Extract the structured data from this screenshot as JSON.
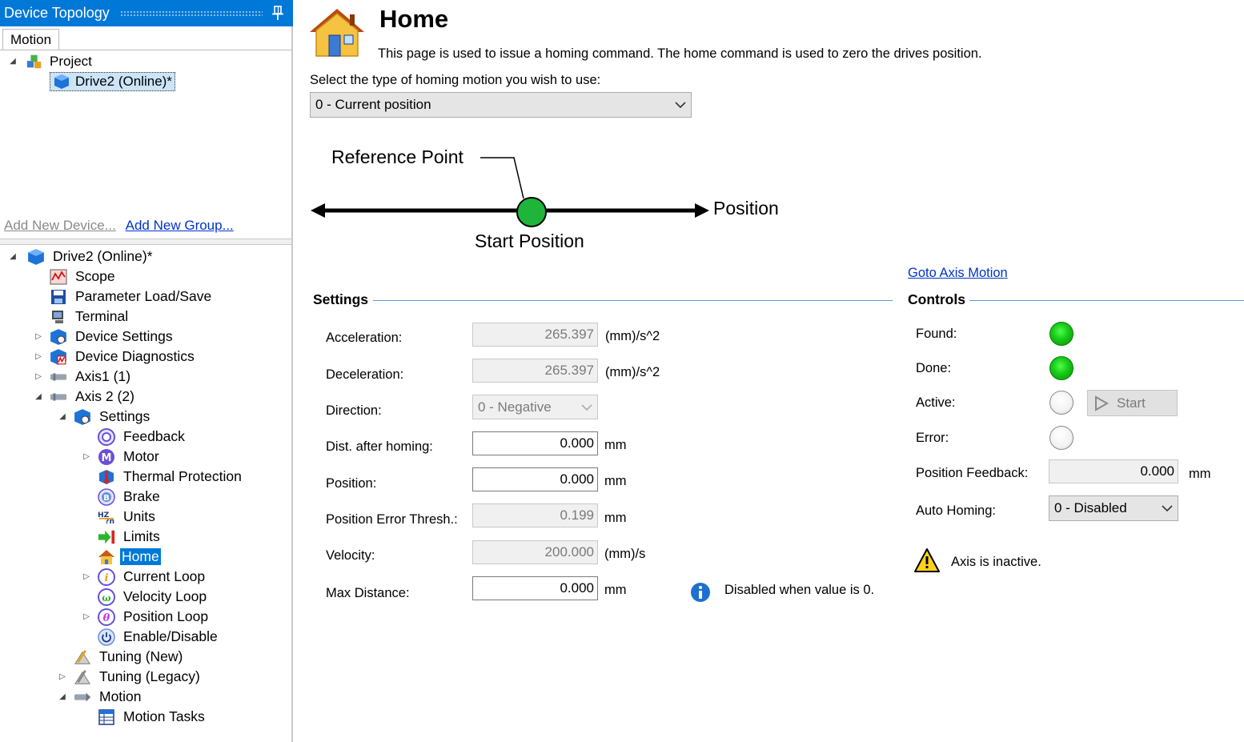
{
  "topology": {
    "title": "Device Topology",
    "tab": "Motion",
    "project_label": "Project",
    "drive_online_label": "Drive2 (Online)*",
    "add_device_link": "Add New Device...",
    "add_group_link": "Add New Group..."
  },
  "tree": {
    "root": "Drive2 (Online)*",
    "scope": "Scope",
    "param": "Parameter Load/Save",
    "terminal": "Terminal",
    "device_settings": "Device Settings",
    "device_diagnostics": "Device Diagnostics",
    "axis1": "Axis1 (1)",
    "axis2": "Axis 2 (2)",
    "settings": "Settings",
    "feedback": "Feedback",
    "motor": "Motor",
    "thermal": "Thermal Protection",
    "brake": "Brake",
    "units": "Units",
    "limits": "Limits",
    "home": "Home",
    "current_loop": "Current Loop",
    "velocity_loop": "Velocity Loop",
    "position_loop": "Position Loop",
    "enable_disable": "Enable/Disable",
    "tuning_new": "Tuning (New)",
    "tuning_legacy": "Tuning (Legacy)",
    "motion": "Motion",
    "motion_tasks": "Motion Tasks"
  },
  "page": {
    "title": "Home",
    "description": "This page is used to issue a homing command. The home command is used to zero the drives position.",
    "select_label": "Select the type of homing motion you wish to use:",
    "homing_type": "0 - Current position"
  },
  "diagram": {
    "reference_point": "Reference Point",
    "position": "Position",
    "start_position": "Start Position"
  },
  "settings": {
    "title": "Settings",
    "acceleration_label": "Acceleration:",
    "acceleration_value": "265.397",
    "acceleration_unit": "(mm)/s^2",
    "deceleration_label": "Deceleration:",
    "deceleration_value": "265.397",
    "deceleration_unit": "(mm)/s^2",
    "direction_label": "Direction:",
    "direction_value": "0 - Negative",
    "dist_label": "Dist. after homing:",
    "dist_value": "0.000",
    "dist_unit": "mm",
    "position_label": "Position:",
    "position_value": "0.000",
    "position_unit": "mm",
    "pos_err_label": "Position Error Thresh.:",
    "pos_err_value": "0.199",
    "pos_err_unit": "mm",
    "velocity_label": "Velocity:",
    "velocity_value": "200.000",
    "velocity_unit": "(mm)/s",
    "max_dist_label": "Max Distance:",
    "max_dist_value": "0.000",
    "max_dist_unit": "mm",
    "info_note": "Disabled when value is 0."
  },
  "controls": {
    "goto_link": "Goto Axis Motion",
    "title": "Controls",
    "found_label": "Found:",
    "done_label": "Done:",
    "active_label": "Active:",
    "error_label": "Error:",
    "start_button": "Start",
    "pos_feedback_label": "Position Feedback:",
    "pos_feedback_value": "0.000",
    "pos_feedback_unit": "mm",
    "auto_homing_label": "Auto Homing:",
    "auto_homing_value": "0 - Disabled",
    "warning": "Axis is inactive."
  },
  "colors": {
    "accent": "#0078d7",
    "led_on": "#17c917",
    "section_line": "#5b9bd5",
    "link": "#0033cc"
  },
  "icons": {
    "pin": "pin-icon",
    "home": "home-icon",
    "info": "info-icon",
    "warning": "warning-icon",
    "play": "play-icon",
    "chevron": "chevron-down-icon"
  }
}
